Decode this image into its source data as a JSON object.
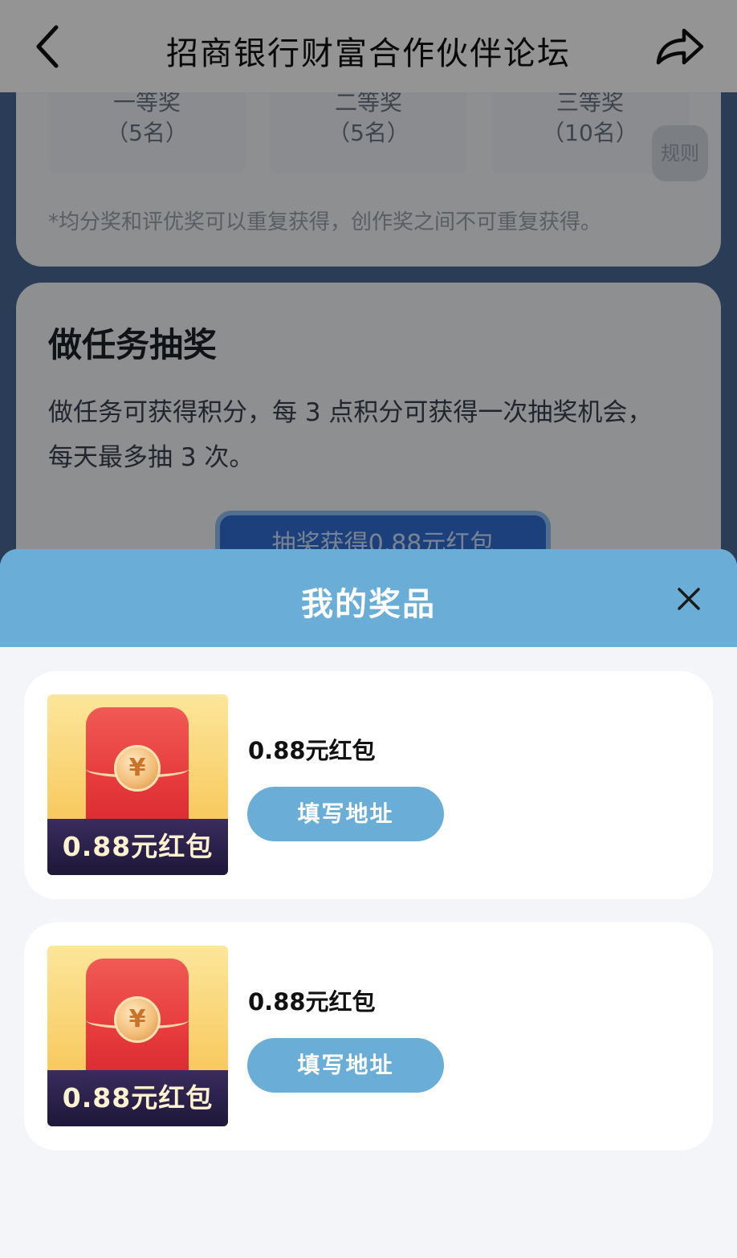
{
  "header": {
    "title": "招商银行财富合作伙伴论坛"
  },
  "prizes_section": {
    "levels": [
      {
        "label": "一等奖",
        "count": "（5名）"
      },
      {
        "label": "二等奖",
        "count": "（5名）"
      },
      {
        "label": "三等奖",
        "count": "（10名）"
      }
    ],
    "rule_button": "规则",
    "note": "*均分奖和评优奖可以重复获得，创作奖之间不可重复获得。"
  },
  "task_section": {
    "title": "做任务抽奖",
    "description": "做任务可获得积分，每 3 点积分可获得一次抽奖机会，每天最多抽 3 次。",
    "cta_partial": "抽奖获得0.88元红包"
  },
  "sheet": {
    "title": "我的奖品",
    "items": [
      {
        "name": "0.88元红包",
        "thumb_text": "0.88元红包",
        "coin_symbol": "¥",
        "button": "填写地址"
      },
      {
        "name": "0.88元红包",
        "thumb_text": "0.88元红包",
        "coin_symbol": "¥",
        "button": "填写地址"
      }
    ]
  },
  "colors": {
    "accent": "#6aaed8",
    "envelope_red": "#e73b3d",
    "banner_dark": "#1d1738"
  }
}
